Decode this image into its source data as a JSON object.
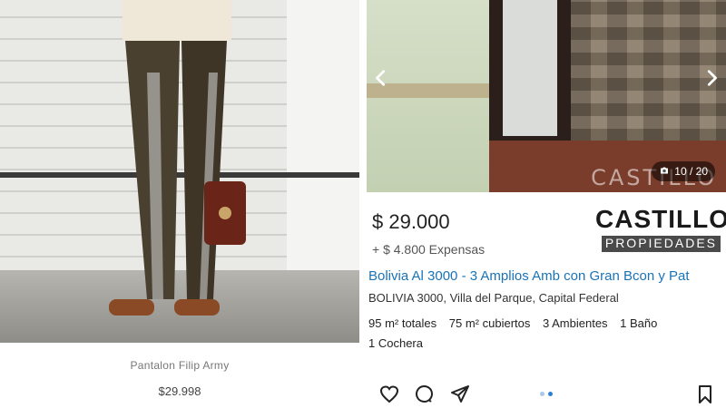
{
  "left_post": {
    "product_name": "Pantalon Filip Army",
    "price": "$29.998"
  },
  "right_post": {
    "image_counter": "10 / 20",
    "watermark": "CASTILLO",
    "price": "$ 29.000",
    "expensas": "+ $ 4.800 Expensas",
    "logo": {
      "top": "CASTILLO",
      "bottom": "PROPIEDADES"
    },
    "title": "Bolivia Al 3000 - 3 Amplios Amb con Gran Bcon y Pat",
    "address": "BOLIVIA 3000, Villa del Parque, Capital Federal",
    "features": [
      "95 m² totales",
      "75 m² cubiertos",
      "3 Ambientes",
      "1 Baño"
    ],
    "features_line2": "1 Cochera",
    "carousel": {
      "total_dots": 2,
      "active_dot": 2
    },
    "icons": [
      "heart-icon",
      "comment-icon",
      "send-icon",
      "bookmark-icon",
      "camera-icon",
      "chevron-left-icon",
      "chevron-right-icon"
    ],
    "colors": {
      "link": "#1a73b7",
      "dot_active": "#2b80d8"
    }
  }
}
